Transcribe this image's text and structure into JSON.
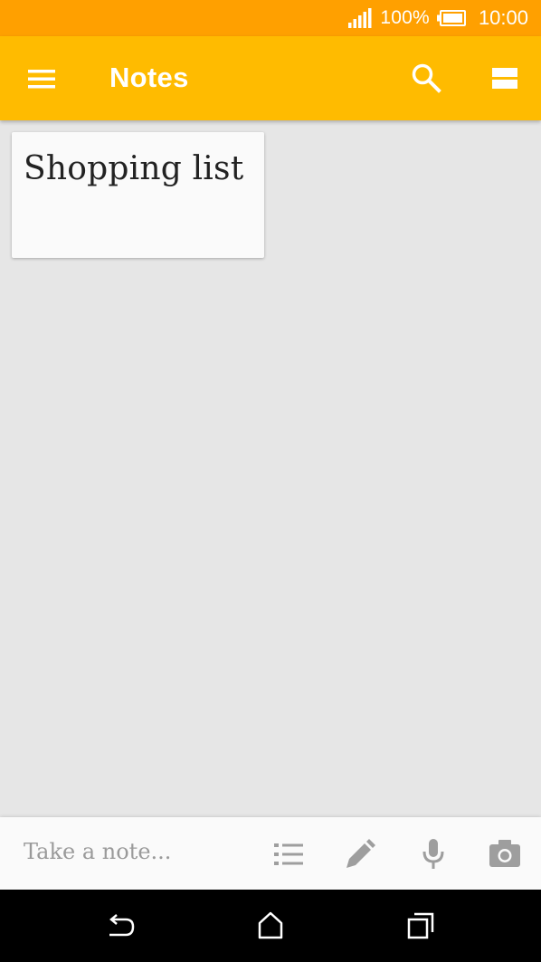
{
  "status_bar": {
    "battery_percent": "100%",
    "time": "10:00",
    "icons": [
      "signal-icon",
      "battery-icon"
    ]
  },
  "app_bar": {
    "title": "Notes",
    "icons": [
      "menu-icon",
      "search-icon",
      "view-toggle-icon"
    ]
  },
  "notes": [
    {
      "title": "Shopping list"
    }
  ],
  "note_bar": {
    "placeholder": "Take a note...",
    "icons": [
      "list-icon",
      "pen-icon",
      "mic-icon",
      "camera-icon"
    ]
  },
  "nav_bar": {
    "icons": [
      "back-icon",
      "home-icon",
      "recents-icon"
    ]
  },
  "colors": {
    "status_bar": "#ffa000",
    "app_bar": "#ffbb00",
    "background": "#e6e6e6",
    "card": "#fafafa",
    "icon_gray": "#9e9e9e"
  }
}
